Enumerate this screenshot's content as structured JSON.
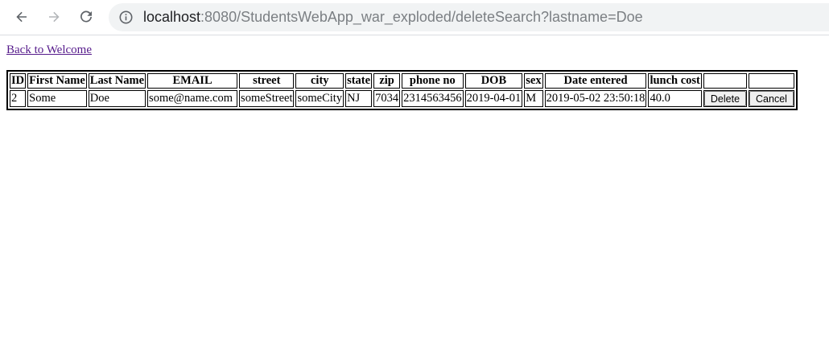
{
  "browser": {
    "url_host": "localhost",
    "url_rest": ":8080/StudentsWebApp_war_exploded/deleteSearch?lastname=Doe",
    "icons": {
      "back": "arrow-left-icon",
      "forward": "arrow-right-icon",
      "reload": "reload-icon",
      "site_info": "info-icon"
    }
  },
  "page": {
    "back_link": "Back to Welcome"
  },
  "table": {
    "headers": [
      "ID",
      "First Name",
      "Last Name",
      "EMAIL",
      "street",
      "city",
      "state",
      "zip",
      "phone no",
      "DOB",
      "sex",
      "Date entered",
      "lunch cost",
      "",
      ""
    ],
    "rows": [
      {
        "cells": [
          "2",
          "Some",
          "Doe",
          "some@name.com",
          "someStreet",
          "someCity",
          "NJ",
          "7034",
          "2314563456",
          "2019-04-01",
          "M",
          "2019-05-02 23:50:18",
          "40.0"
        ],
        "delete_label": "Delete",
        "cancel_label": "Cancel"
      }
    ]
  },
  "colors": {
    "link_visited": "#551a8b",
    "omnibox_bg": "#f1f3f4",
    "button_bg": "#efefef"
  }
}
